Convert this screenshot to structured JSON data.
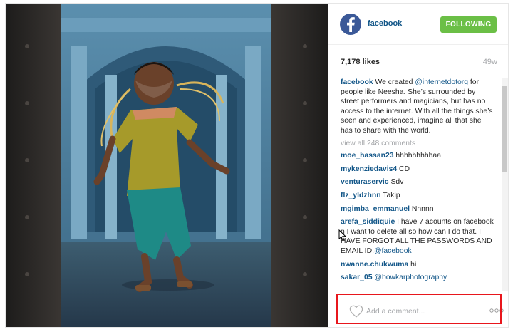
{
  "post": {
    "username": "facebook",
    "follow_label": "FOLLOWING",
    "likes": "7,178 likes",
    "age": "49w"
  },
  "caption": {
    "username": "facebook",
    "text_before": " We created ",
    "mention": "@internetdotorg",
    "text_after": " for people like Neesha. She’s surrounded by street performers and magicians, but has no access to the internet. With all the things she’s seen and experienced, imagine all that she has to share with the world."
  },
  "view_all": "view all 248 comments",
  "comments": [
    {
      "user": "moe_hassan23",
      "text": " hhhhhhhhhaa"
    },
    {
      "user": "mykenziedavis4",
      "text": " CD"
    },
    {
      "user": "venturaservic",
      "text": " Sdv"
    },
    {
      "user": "flz_yldzhnn",
      "text": " Takip"
    },
    {
      "user": "mgimba_emmanuel",
      "text": " Nnnnn"
    },
    {
      "user": "arefa_siddiquie",
      "text": " I have 7 acounts on facebook n I want to delete all so how can I do that. I HAVE FORGOT ALL THE PASSWORDS AND EMAIL ID.",
      "mention": "@facebook"
    },
    {
      "user": "nwanne.chukwuma",
      "text": " hi"
    },
    {
      "user": "sakar_05",
      "text": " ",
      "mention": "@bowkarphotography"
    }
  ],
  "add_comment": {
    "placeholder": "Add a comment..."
  },
  "icons": {
    "avatar": "facebook-logo-icon",
    "like": "heart-outline-icon",
    "more": "more-options-icon"
  },
  "colors": {
    "follow_button": "#6bbf46",
    "link": "#125688",
    "highlight_box": "#e8161c"
  }
}
